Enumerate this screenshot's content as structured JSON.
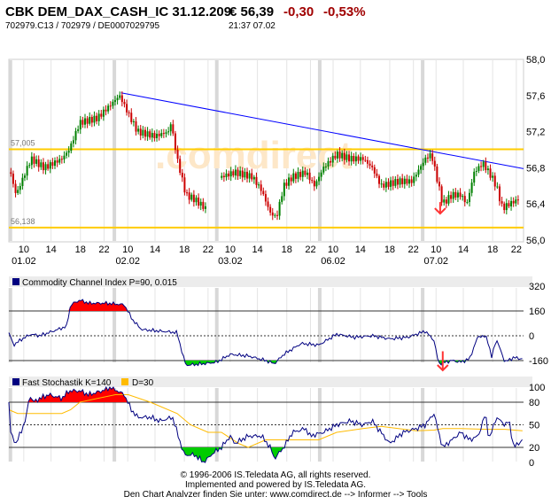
{
  "header": {
    "title": "CBK DEM_DAX_CASH_IC 31.12.209",
    "price": "€ 56,39",
    "change": "-0,30",
    "change_pct": "-0,53%",
    "ids": "702979.C13  /  702979  /  DE0007029795",
    "time": "21:37   07.02"
  },
  "watermark": ".comdirect",
  "colors": {
    "up": "#008000",
    "down": "#cc0000",
    "trend": "#0000ff",
    "support": "#ffcc00",
    "indicator": "#000080",
    "signal": "#ffbb00",
    "arrow": "#ff3333"
  },
  "footer": [
    "© 1996-2006 IS.Teledata AG, all rights reserved.",
    "Implemented and powered by IS.Teledata AG.",
    "Den Chart Analyzer finden Sie unter: www.comdirect.de --> Informer --> Tools"
  ],
  "chart_data": [
    {
      "type": "candlestick",
      "title": "CBK DEM_DAX_CASH_IC 31.12.209",
      "x_domain": [
        0,
        100
      ],
      "ylim": [
        56.0,
        58.0
      ],
      "y_ticks": [
        "58,0",
        "57,6",
        "57,2",
        "56,8",
        "56,4",
        "56,0"
      ],
      "y_tick_values": [
        58.0,
        57.6,
        57.2,
        56.8,
        56.4,
        56.0
      ],
      "hour_labels": [
        "10",
        "14",
        "18",
        "22"
      ],
      "days": [
        {
          "label": "01.02",
          "start": 0.3
        },
        {
          "label": "02.02",
          "start": 20.5
        },
        {
          "label": "03.02",
          "start": 40.4
        },
        {
          "label": "06.02",
          "start": 60.4
        },
        {
          "label": "07.02",
          "start": 80.4
        }
      ],
      "hour_offsets": [
        2.6,
        7.9,
        13.6,
        18.2
      ],
      "support_lines": [
        {
          "label": "57,005",
          "value": 57.005
        },
        {
          "label": "56,138",
          "value": 56.138
        }
      ],
      "trend_line": [
        [
          21.8,
          57.63
        ],
        [
          100,
          56.79
        ]
      ],
      "signal_arrow": {
        "t": 83.8,
        "price": 56.45
      },
      "close_path": [
        [
          0.3,
          56.75
        ],
        [
          1.4,
          56.5
        ],
        [
          4.3,
          56.9
        ],
        [
          6.9,
          56.8
        ],
        [
          10.3,
          56.9
        ],
        [
          11.7,
          57.0
        ],
        [
          13.8,
          57.3
        ],
        [
          17.2,
          57.35
        ],
        [
          19.8,
          57.5
        ],
        [
          21.5,
          57.6
        ],
        [
          23.2,
          57.4
        ],
        [
          25,
          57.2
        ],
        [
          28.4,
          57.15
        ],
        [
          31,
          57.2
        ],
        [
          31.5,
          57.3
        ],
        [
          32.7,
          56.9
        ],
        [
          34.4,
          56.5
        ],
        [
          36.1,
          56.45
        ],
        [
          38.2,
          56.35
        ],
        [
          41.3,
          56.7
        ],
        [
          43.9,
          56.75
        ],
        [
          47.3,
          56.7
        ],
        [
          49.1,
          56.55
        ],
        [
          50.8,
          56.3
        ],
        [
          52,
          56.25
        ],
        [
          53.4,
          56.6
        ],
        [
          55.1,
          56.7
        ],
        [
          57.7,
          56.75
        ],
        [
          59.4,
          56.6
        ],
        [
          61.1,
          56.8
        ],
        [
          63.7,
          56.95
        ],
        [
          66.3,
          56.9
        ],
        [
          68.8,
          56.9
        ],
        [
          70.6,
          56.8
        ],
        [
          72.3,
          56.6
        ],
        [
          75.7,
          56.65
        ],
        [
          78.3,
          56.65
        ],
        [
          80.9,
          56.9
        ],
        [
          82.1,
          56.95
        ],
        [
          83.5,
          56.6
        ],
        [
          84.3,
          56.4
        ],
        [
          86.1,
          56.5
        ],
        [
          87.8,
          56.5
        ],
        [
          89,
          56.4
        ],
        [
          90.4,
          56.75
        ],
        [
          92.1,
          56.85
        ],
        [
          93.8,
          56.7
        ],
        [
          94.7,
          56.6
        ],
        [
          95.9,
          56.35
        ],
        [
          97.2,
          56.4
        ],
        [
          99,
          56.45
        ]
      ]
    },
    {
      "type": "line",
      "title": "Commodity Channel Index P=90, 0.015",
      "ylim": [
        -177,
        314
      ],
      "y_ticks": [
        "320",
        "160",
        "0",
        "-160"
      ],
      "y_tick_values": [
        320,
        160,
        0,
        -160
      ],
      "bands": [
        160,
        -160
      ],
      "signal_arrow": {
        "t": 84.3,
        "value": -100
      },
      "series": [
        {
          "name": "CCI",
          "points": [
            [
              0,
              20
            ],
            [
              0.9,
              -60
            ],
            [
              2.6,
              -20
            ],
            [
              4.3,
              10
            ],
            [
              6,
              0
            ],
            [
              8.6,
              30
            ],
            [
              11.2,
              60
            ],
            [
              12,
              200
            ],
            [
              13.8,
              230
            ],
            [
              15.5,
              210
            ],
            [
              18.9,
              210
            ],
            [
              22.4,
              200
            ],
            [
              24.1,
              100
            ],
            [
              25.8,
              40
            ],
            [
              29.3,
              30
            ],
            [
              32.7,
              20
            ],
            [
              33.6,
              -100
            ],
            [
              34.4,
              -190
            ],
            [
              37.9,
              -180
            ],
            [
              40.4,
              -170
            ],
            [
              43,
              -120
            ],
            [
              46.5,
              -130
            ],
            [
              49.9,
              -160
            ],
            [
              51.6,
              -180
            ],
            [
              53.4,
              -120
            ],
            [
              56.8,
              -50
            ],
            [
              60.2,
              -60
            ],
            [
              63.7,
              10
            ],
            [
              67.1,
              -10
            ],
            [
              70.6,
              0
            ],
            [
              74,
              -20
            ],
            [
              77.5,
              -10
            ],
            [
              80.9,
              30
            ],
            [
              82.6,
              -30
            ],
            [
              83.5,
              -180
            ],
            [
              86.1,
              -160
            ],
            [
              87.8,
              -170
            ],
            [
              89.5,
              -150
            ],
            [
              91.2,
              0
            ],
            [
              92.9,
              -10
            ],
            [
              93.8,
              -140
            ],
            [
              94.7,
              -20
            ],
            [
              96.4,
              -170
            ],
            [
              98.1,
              -140
            ],
            [
              99.8,
              -150
            ]
          ]
        }
      ]
    },
    {
      "type": "line",
      "title": "Fast Stochastik K=140",
      "ylim": [
        0,
        100
      ],
      "y_ticks": [
        "100",
        "80",
        "50",
        "20",
        "0"
      ],
      "y_tick_values": [
        100,
        80,
        50,
        20,
        0
      ],
      "bands": [
        80,
        20
      ],
      "series": [
        {
          "name": "Fast Stochastik K=140",
          "points": [
            [
              0,
              80
            ],
            [
              0.3,
              40
            ],
            [
              1.4,
              25
            ],
            [
              2.6,
              45
            ],
            [
              3.4,
              60
            ],
            [
              4,
              90
            ],
            [
              4.8,
              80
            ],
            [
              6,
              85
            ],
            [
              7.7,
              90
            ],
            [
              10.3,
              85
            ],
            [
              11.7,
              95
            ],
            [
              13.8,
              95
            ],
            [
              15.5,
              90
            ],
            [
              18.1,
              95
            ],
            [
              19.8,
              100
            ],
            [
              22.4,
              90
            ],
            [
              23.8,
              70
            ],
            [
              25,
              60
            ],
            [
              27.5,
              60
            ],
            [
              29.3,
              55
            ],
            [
              31.8,
              60
            ],
            [
              33.6,
              20
            ],
            [
              34.1,
              10
            ],
            [
              36.1,
              10
            ],
            [
              37.9,
              0
            ],
            [
              39.6,
              12
            ],
            [
              41.3,
              20
            ],
            [
              43,
              35
            ],
            [
              43.9,
              25
            ],
            [
              46.5,
              35
            ],
            [
              49.1,
              35
            ],
            [
              50.8,
              20
            ],
            [
              51.6,
              5
            ],
            [
              53.4,
              20
            ],
            [
              55.1,
              40
            ],
            [
              57.7,
              45
            ],
            [
              58.5,
              35
            ],
            [
              61.1,
              40
            ],
            [
              63.7,
              50
            ],
            [
              66.3,
              55
            ],
            [
              68.8,
              50
            ],
            [
              70.6,
              55
            ],
            [
              72.3,
              40
            ],
            [
              74,
              25
            ],
            [
              76.6,
              40
            ],
            [
              79.2,
              45
            ],
            [
              80.9,
              50
            ],
            [
              82.6,
              65
            ],
            [
              83.5,
              40
            ],
            [
              84.3,
              20
            ],
            [
              86.1,
              30
            ],
            [
              87.8,
              40
            ],
            [
              89.5,
              30
            ],
            [
              91.2,
              35
            ],
            [
              92.6,
              65
            ],
            [
              93.3,
              30
            ],
            [
              94.7,
              60
            ],
            [
              96.4,
              50
            ],
            [
              97.2,
              55
            ],
            [
              98.1,
              20
            ],
            [
              99.8,
              30
            ]
          ]
        },
        {
          "name": "D=30",
          "points": [
            [
              0,
              70
            ],
            [
              1.7,
              65
            ],
            [
              6.9,
              65
            ],
            [
              10.3,
              65
            ],
            [
              12,
              70
            ],
            [
              13.8,
              80
            ],
            [
              17.2,
              85
            ],
            [
              20.7,
              90
            ],
            [
              23.2,
              90
            ],
            [
              27.5,
              80
            ],
            [
              32.7,
              65
            ],
            [
              35.3,
              50
            ],
            [
              38.7,
              40
            ],
            [
              41.3,
              40
            ],
            [
              44.7,
              25
            ],
            [
              46.5,
              20
            ],
            [
              49.9,
              30
            ],
            [
              55.1,
              30
            ],
            [
              60.2,
              30
            ],
            [
              63.7,
              40
            ],
            [
              68.8,
              45
            ],
            [
              72.3,
              48
            ],
            [
              75.7,
              45
            ],
            [
              79.2,
              42
            ],
            [
              82.6,
              43
            ],
            [
              84.3,
              45
            ],
            [
              87.8,
              45
            ],
            [
              92.9,
              44
            ],
            [
              96.4,
              44
            ],
            [
              99.8,
              42
            ]
          ]
        }
      ]
    }
  ]
}
